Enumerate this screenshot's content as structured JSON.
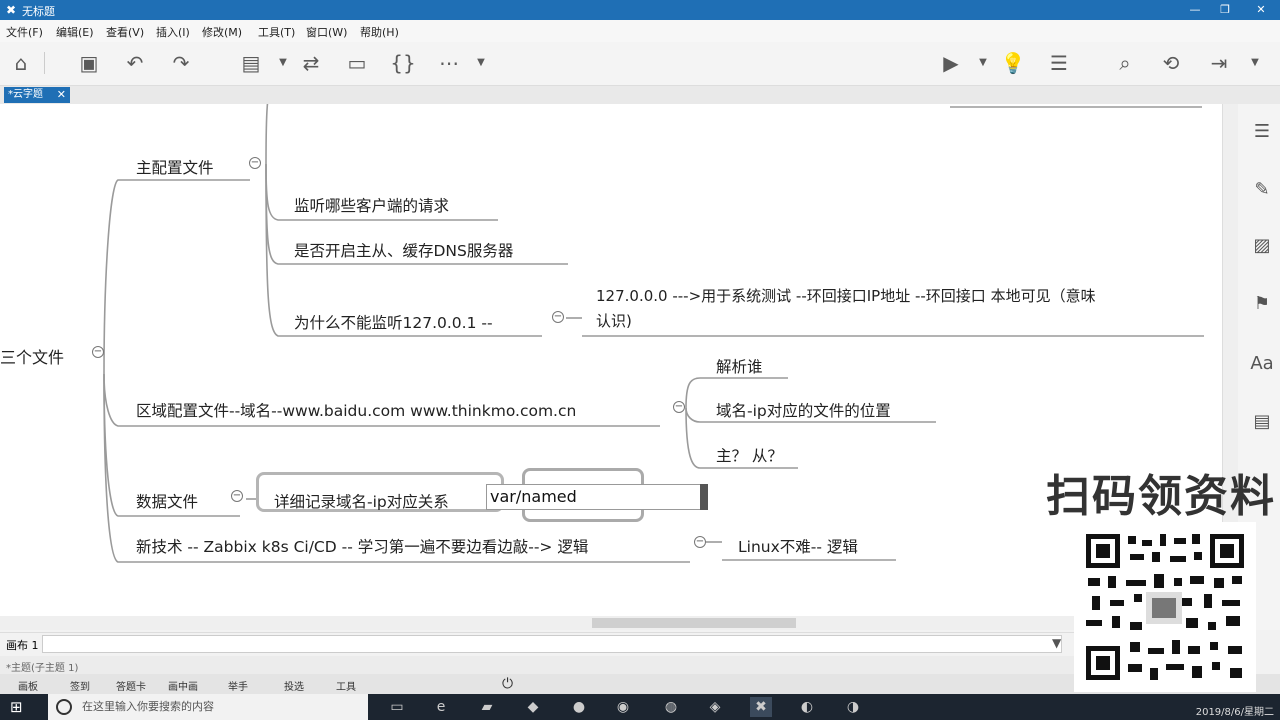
{
  "window": {
    "title": "无标题"
  },
  "menu": [
    "文件(F)",
    "编辑(E)",
    "查看(V)",
    "插入(I)",
    "修改(M)",
    "工具(T)",
    "窗口(W)",
    "帮助(H)"
  ],
  "tab": {
    "label": "*云字题"
  },
  "mindmap": {
    "root": "三个文件",
    "main_config": {
      "label": "主配置文件",
      "children": [
        "监听哪些客户端的请求",
        "是否开启主从、缓存DNS服务器",
        "为什么不能监听127.0.0.1 --"
      ],
      "loopback_note_line1": "127.0.0.0 --->用于系统测试 --环回接口IP地址 --环回接口 本地可见（意味",
      "loopback_note_line2": "认识)"
    },
    "zone_config": {
      "label": "区域配置文件--域名--www.baidu.com  www.thinkmo.com.cn",
      "children": [
        "解析谁",
        "域名-ip对应的文件的位置",
        "主？ 从？"
      ]
    },
    "data_file": {
      "label": "数据文件",
      "child": "详细记录域名-ip对应关系",
      "edit_value": "var/named"
    },
    "new_tech": {
      "label": "新技术 -- Zabbix k8s Ci/CD -- 学习第一遍不要边看边敲--> 逻辑",
      "child": "Linux不难-- 逻辑"
    }
  },
  "sheet": {
    "tab": "画布 1"
  },
  "status": {
    "text": "*主题(子主题 1)"
  },
  "dock": [
    "画板",
    "签到",
    "答题卡",
    "画中画",
    "举手",
    "投选",
    "工具"
  ],
  "taskbar": {
    "search_placeholder": "在这里输入你要搜索的内容",
    "clock": "2019/8/6/星期二"
  },
  "overlay": {
    "text": "扫码领资料"
  }
}
